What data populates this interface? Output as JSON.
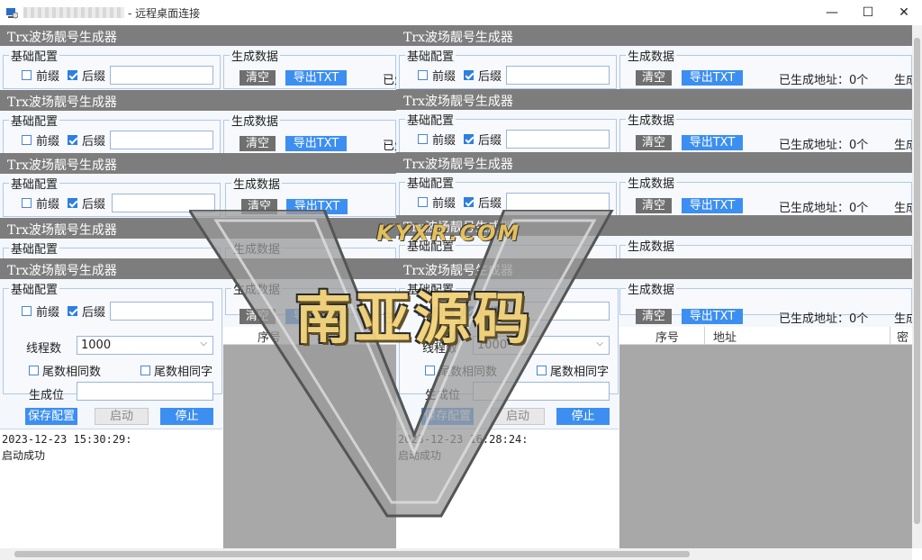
{
  "titlebar": {
    "title": "- 远程桌面连接",
    "minimize": "—",
    "maximize": "☐",
    "close": "✕"
  },
  "app": {
    "header": "Trx波场靓号生成器",
    "basic_config": "基础配置",
    "gen_data": "生成数据",
    "prefix": "前缀",
    "suffix": "后缀",
    "clear": "清空",
    "export": "导出TXT",
    "generated_count_left": "已生",
    "generated_count": "已生成地址：0个",
    "generated_cut": "生成",
    "thread_label": "线程数",
    "thread_value": "1000",
    "tail_same_num": "尾数相同数",
    "tail_same_char": "尾数相同字",
    "gen_pos": "生成位",
    "save_config": "保存配置",
    "start": "启动",
    "stop": "停止",
    "col_index": "序号",
    "col_address": "地址",
    "col_key": "密"
  },
  "logs": {
    "left": {
      "time": "2023-12-23 15:30:29:",
      "msg": "启动成功"
    },
    "right": {
      "time": "2023-12-23 16:28:24:",
      "msg": "启动成功"
    }
  },
  "watermark": {
    "site": "KYXR.COM",
    "main": "南亚源码"
  },
  "colors": {
    "header_bg": "#7d7d7d",
    "accent_blue": "#3c8ff0",
    "gray_button": "#6f6f6f"
  }
}
